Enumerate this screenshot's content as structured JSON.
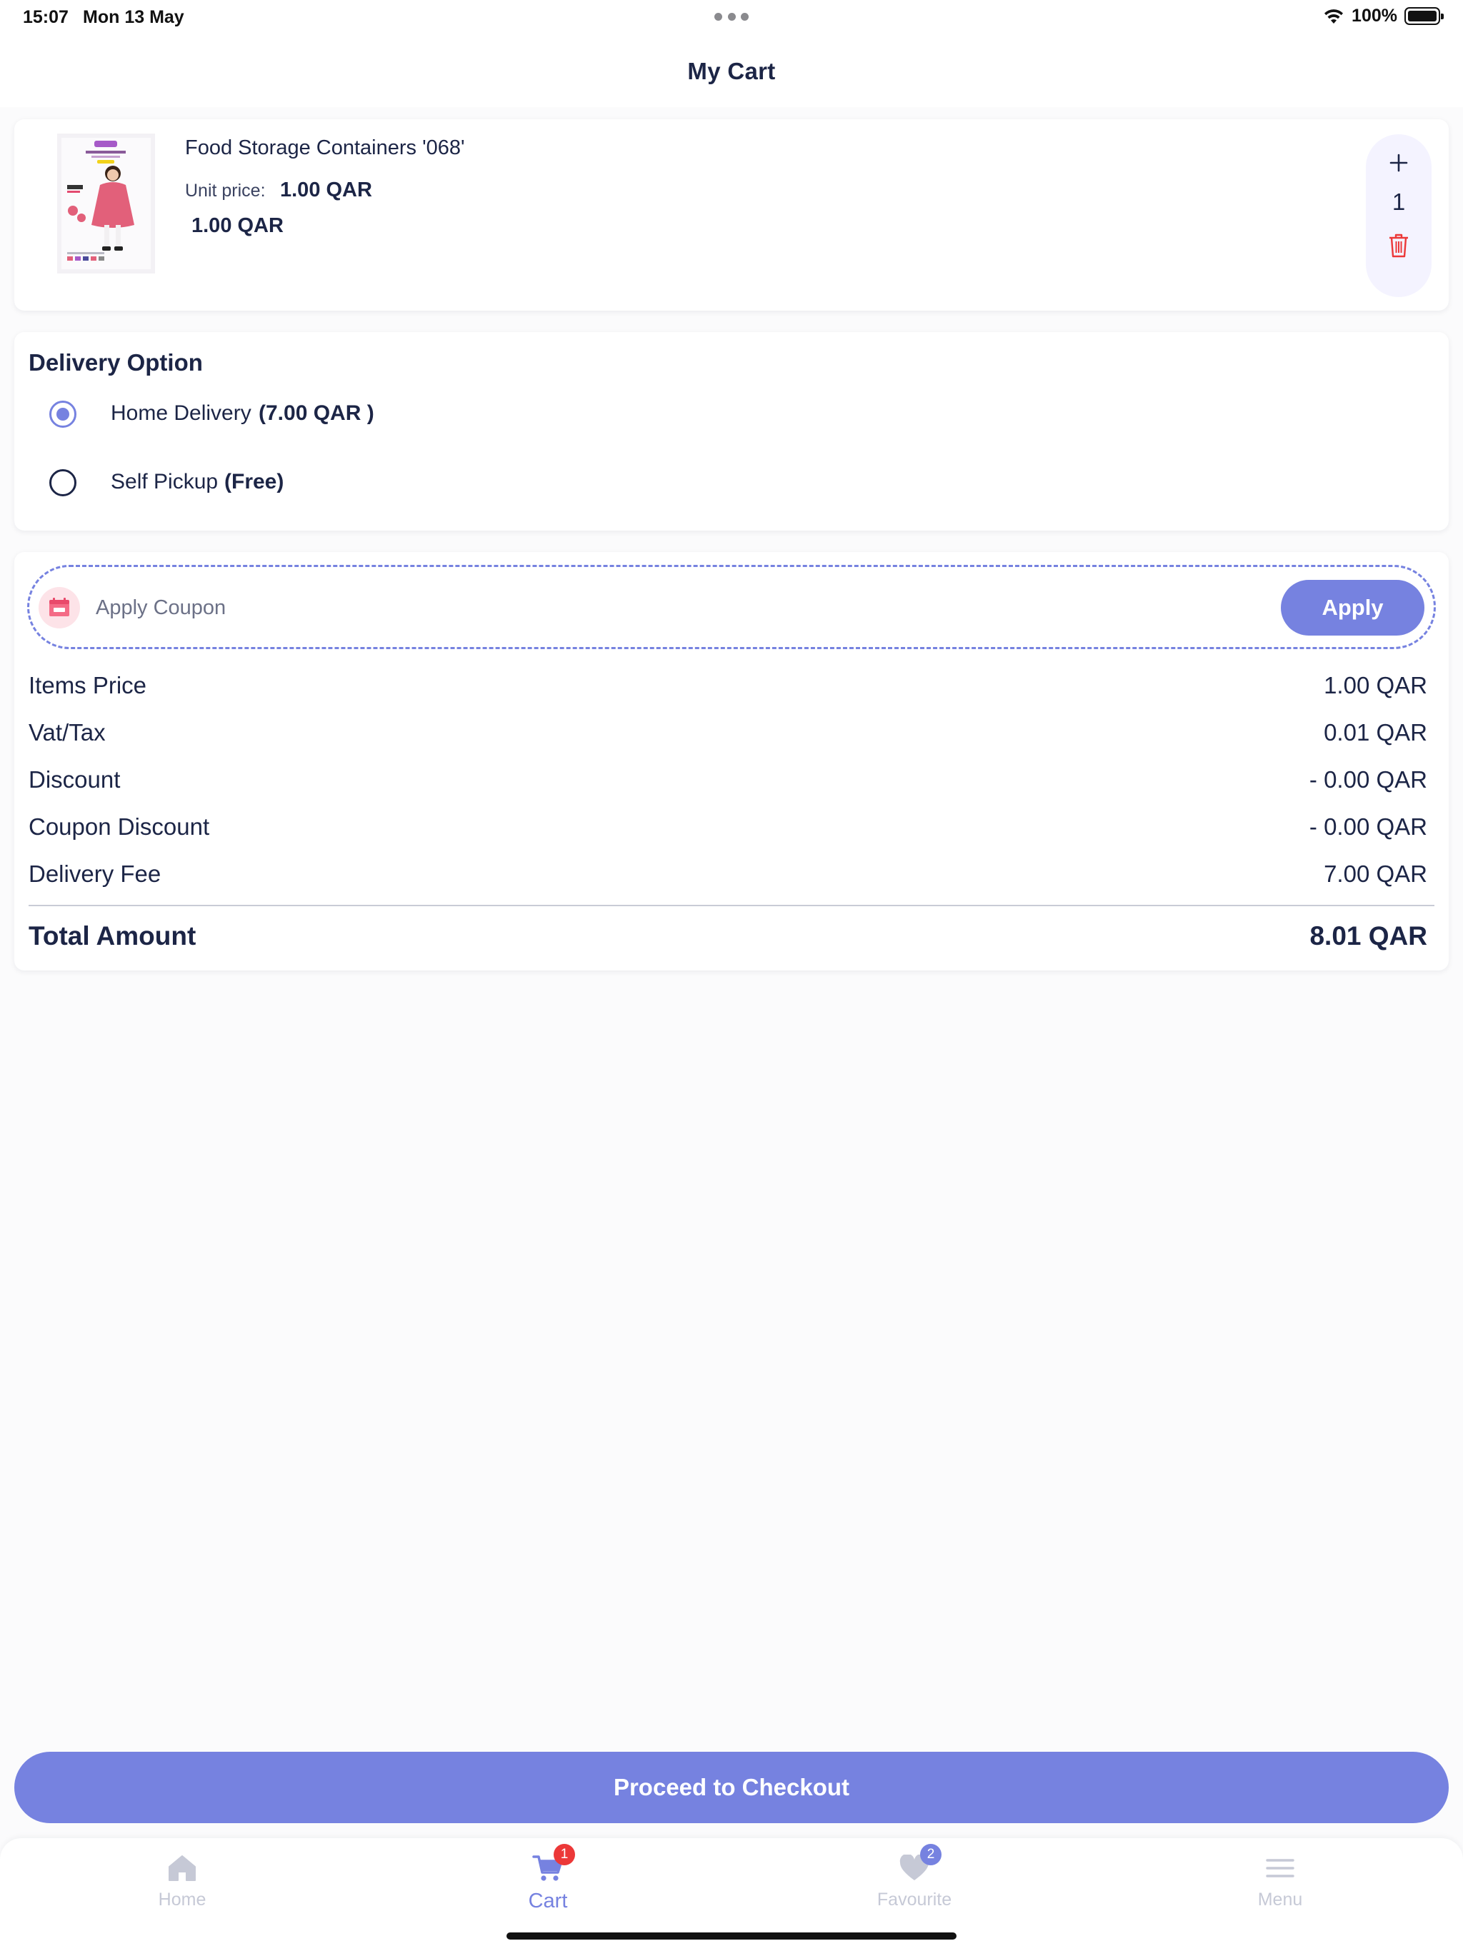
{
  "status_bar": {
    "time": "15:07",
    "date": "Mon 13 May",
    "battery": "100%"
  },
  "header": {
    "title": "My Cart"
  },
  "cart_item": {
    "name": "Food Storage Containers '068'",
    "unit_price_label": "Unit price:",
    "unit_price": "1.00 QAR",
    "line_total": "1.00 QAR",
    "quantity": "1"
  },
  "delivery": {
    "title": "Delivery Option",
    "options": [
      {
        "label": "Home Delivery",
        "price": "(7.00 QAR )",
        "selected": true
      },
      {
        "label": "Self Pickup",
        "price": "(Free)",
        "selected": false
      }
    ]
  },
  "coupon": {
    "placeholder": "Apply Coupon",
    "apply_label": "Apply"
  },
  "summary": {
    "rows": [
      {
        "label": "Items Price",
        "value": "1.00 QAR"
      },
      {
        "label": "Vat/Tax",
        "value": "0.01 QAR"
      },
      {
        "label": "Discount",
        "value": "- 0.00 QAR"
      },
      {
        "label": "Coupon Discount",
        "value": "- 0.00 QAR"
      },
      {
        "label": "Delivery Fee",
        "value": "7.00 QAR"
      }
    ],
    "total_label": "Total Amount",
    "total_value": "8.01 QAR"
  },
  "checkout": {
    "label": "Proceed to Checkout"
  },
  "tabs": [
    {
      "label": "Home",
      "icon": "home-icon"
    },
    {
      "label": "Cart",
      "icon": "cart-icon",
      "badge": "1"
    },
    {
      "label": "Favourite",
      "icon": "heart-icon",
      "badge": "2"
    },
    {
      "label": "Menu",
      "icon": "menu-icon"
    }
  ],
  "colors": {
    "accent": "#7682e0",
    "text": "#1c2546",
    "danger": "#ec3838",
    "muted": "#c6c9d6"
  }
}
